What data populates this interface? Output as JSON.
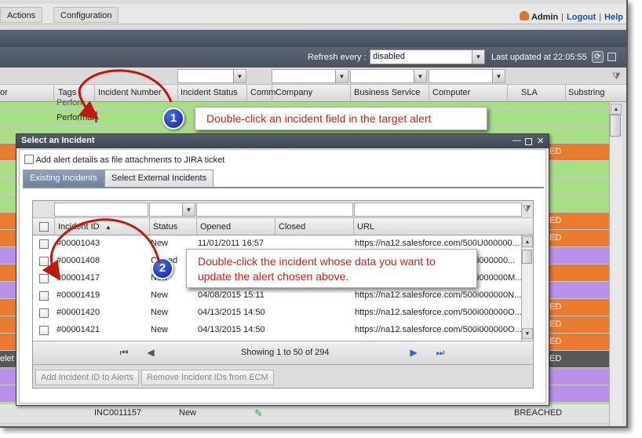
{
  "menubar": {
    "actions": "Actions",
    "configuration": "Configuration"
  },
  "user": {
    "name": "Admin",
    "logout": "Logout",
    "help": "Help",
    "separator": "|"
  },
  "refresh": {
    "label": "Refresh every :",
    "value": "disabled",
    "last_updated": "Last updated at 22:05:55"
  },
  "grid": {
    "columns": [
      "or",
      "Tags",
      "Incident Number",
      "Incident Status",
      "Comm",
      "Company",
      "Business Service",
      "Computer",
      "SLA",
      "Substring"
    ],
    "highlight_row": {
      "partial_text": "Perforn",
      "tags": "Performai"
    },
    "row_labels": [
      "ED",
      "ED",
      "ED",
      "ED",
      "ED",
      "ED",
      "ED"
    ],
    "gray_row_left": "elet",
    "bottom_row": {
      "incident": "INC0011157",
      "status": "New",
      "sla": "BREACHED"
    }
  },
  "callout1": {
    "number": "1",
    "text": "Double-click an incident field in the target alert"
  },
  "dialog": {
    "title": "Select an Incident",
    "attach_label": "Add alert details as file attachments to JIRA ticket",
    "tabs": [
      "Existing Incidents",
      "Select External Incidents"
    ],
    "columns": [
      "Incident ID",
      "Status",
      "Opened",
      "Closed",
      "URL"
    ],
    "rows": [
      {
        "id": "#00001043",
        "status": "New",
        "opened": "11/01/2011 16:57",
        "closed": "",
        "url": "https://na12.salesforce.com/500U000000..."
      },
      {
        "id": "#00001408",
        "status": "Closed",
        "opened": "",
        "closed": "",
        "url": "https://na12.salesforce.com/500i000000..."
      },
      {
        "id": "#00001417",
        "status": "New",
        "opened": "",
        "closed": "",
        "url": "https://na12.salesforce.com/500i000000M..."
      },
      {
        "id": "#00001419",
        "status": "New",
        "opened": "04/08/2015 15:11",
        "closed": "",
        "url": "https://na12.salesforce.com/500i000000N..."
      },
      {
        "id": "#00001420",
        "status": "New",
        "opened": "04/13/2015 14:50",
        "closed": "",
        "url": "https://na12.salesforce.com/500i000000O..."
      },
      {
        "id": "#00001421",
        "status": "New",
        "opened": "04/13/2015 14:50",
        "closed": "",
        "url": "https://na12.salesforce.com/500i000000O..."
      }
    ],
    "showing": "Showing 1 to 50 of 294",
    "buttons": {
      "add": "Add Incident ID to Alerts",
      "remove": "Remove Incident IDs from ECM"
    }
  },
  "callout2": {
    "number": "2",
    "text": "Double-click the incident whose data you want to update the alert chosen above."
  },
  "colors": {
    "green": "#a6df84",
    "orange": "#ea7a2e",
    "purple": "#b991e8",
    "callout_text": "#c0251a",
    "badge": "#1a33c8",
    "arrow": "#c0180f"
  }
}
